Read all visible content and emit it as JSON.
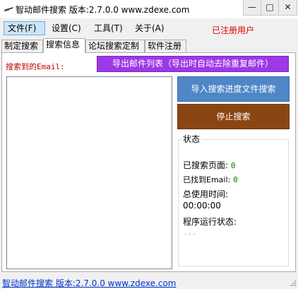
{
  "window": {
    "title": "智动邮件搜索 版本:2.7.0.0 www.zdexe.com",
    "min_label": "—",
    "max_label": "□",
    "close_label": "✕"
  },
  "menu": {
    "file": "文件(F)",
    "settings": "设置(C)",
    "tools": "工具(T)",
    "about": "关于(A)"
  },
  "registered_label": "已注册用户",
  "tabs": [
    "制定搜索",
    "搜索信息",
    "论坛搜索定制",
    "软件注册"
  ],
  "active_tab": "搜索信息",
  "main": {
    "email_label": "搜索到的Email:",
    "export_button": "导出邮件列表（导出时自动去除重复邮件）",
    "import_button": "导入搜索进度文件搜索",
    "stop_button": "停止搜索",
    "results": []
  },
  "status": {
    "legend": "状态",
    "pages_label": "已搜索页面:",
    "pages_value": "0",
    "emails_label": "已找到Email:",
    "emails_value": "0",
    "time_label": "总使用时间:",
    "time_value": "00:00:00",
    "run_label": "程序运行状态:",
    "run_value": "..."
  },
  "footer": {
    "link": "智动邮件搜索 版本:2.7.0.0 www.zdexe.com"
  },
  "colors": {
    "export_button": "#9d38e7",
    "import_button": "#4f86c6",
    "stop_button": "#8b4513",
    "registered": "#e00000",
    "status_value": "#008000",
    "footer_link": "#0033cc"
  }
}
